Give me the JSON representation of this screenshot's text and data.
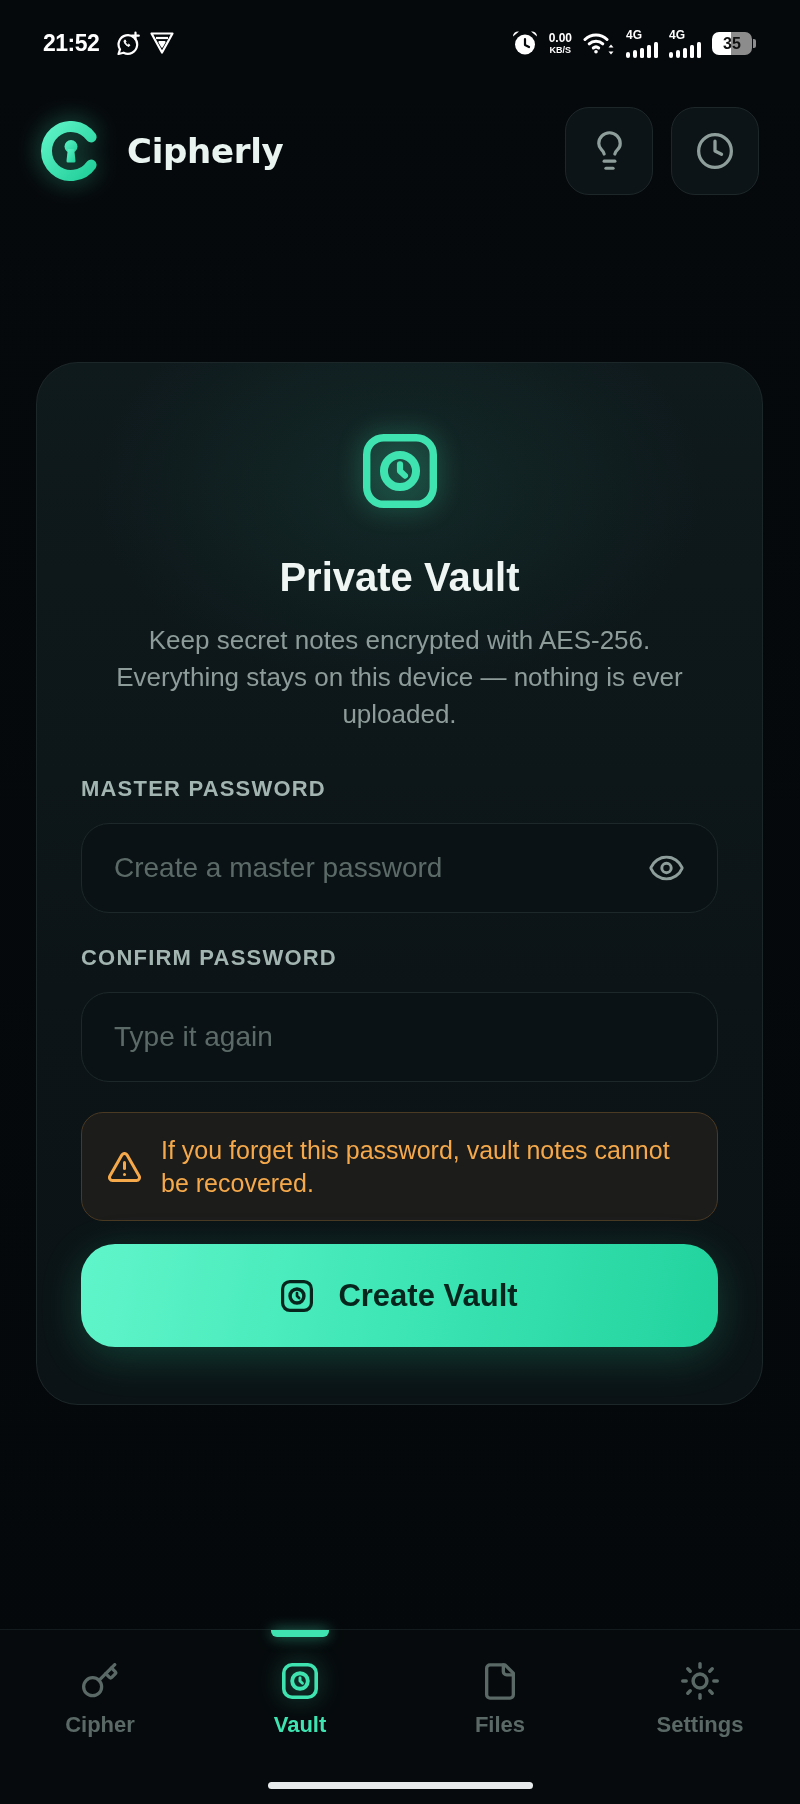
{
  "status_bar": {
    "time": "21:52",
    "network_speed": "0.00",
    "network_speed_unit": "KB/S",
    "sim_networks": [
      "4G",
      "4G"
    ],
    "battery": "35"
  },
  "header": {
    "app_name": "Cipherly"
  },
  "vault_card": {
    "title": "Private Vault",
    "description": "Keep secret notes encrypted with AES-256. Everything stays on this device — nothing is ever uploaded.",
    "fields": [
      {
        "label": "MASTER PASSWORD",
        "placeholder": "Create a master password",
        "reveal_toggle": true
      },
      {
        "label": "CONFIRM PASSWORD",
        "placeholder": "Type it again",
        "reveal_toggle": false
      }
    ],
    "warning": "If you forget this password, vault notes cannot be recovered.",
    "button": "Create Vault"
  },
  "bottom_nav": [
    {
      "label": "Cipher",
      "selected": false
    },
    {
      "label": "Vault",
      "selected": true
    },
    {
      "label": "Files",
      "selected": false
    },
    {
      "label": "Settings",
      "selected": false
    }
  ]
}
